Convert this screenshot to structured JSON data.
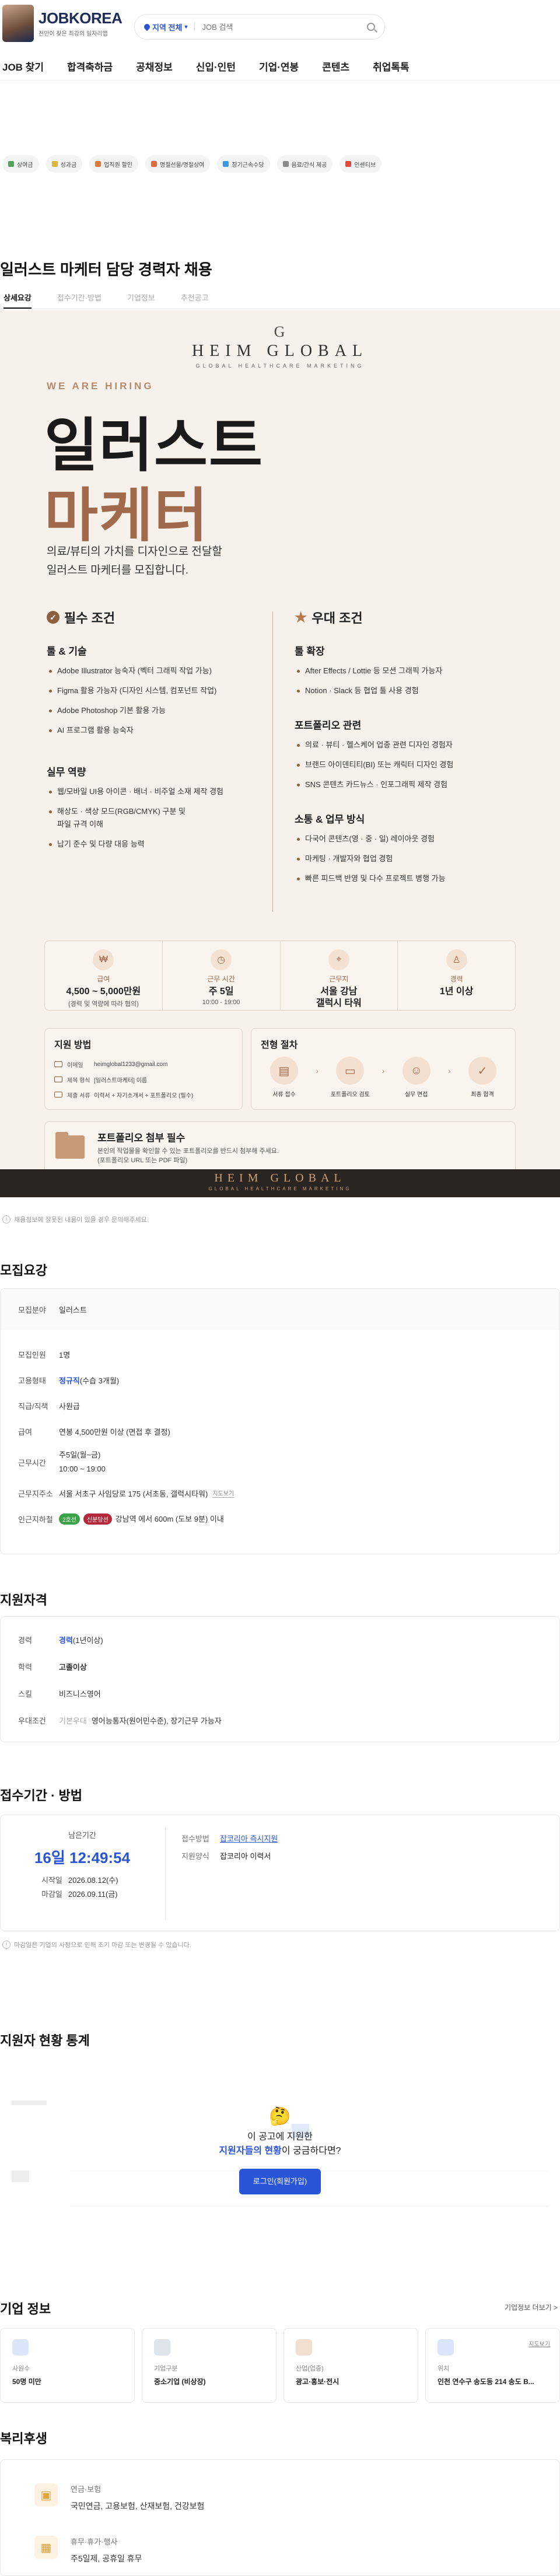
{
  "header": {
    "logo": "JOBKOREA",
    "logo_sub": "천만이 찾은 최강의 일자리앱",
    "location": "지역 전체",
    "search_placeholder": "JOB 검색"
  },
  "gnb": [
    "JOB 찾기",
    "합격축하금",
    "공채정보",
    "신입·인턴",
    "기업·연봉",
    "콘텐츠",
    "취업톡톡"
  ],
  "chips": [
    {
      "label": "상여금",
      "color": "#5aa05a"
    },
    {
      "label": "성과금",
      "color": "#e2b33c"
    },
    {
      "label": "업직원 할인",
      "color": "#e27a3c"
    },
    {
      "label": "명절선물/명절상여",
      "color": "#e26a3c"
    },
    {
      "label": "장기근속수당",
      "color": "#3c9ae2"
    },
    {
      "label": "음료/간식 제공",
      "color": "#8a8a8a"
    },
    {
      "label": "인센티브",
      "color": "#e24a3c"
    }
  ],
  "title": "일러스트 마케터 담당 경력자 채용",
  "tabs": [
    "상세요강",
    "접수기간·방법",
    "기업정보",
    "추천공고"
  ],
  "poster": {
    "g": "G",
    "brand": "HEIM GLOBAL",
    "brand_sub": "GLOBAL HEALTHCARE MARKETING",
    "hiring": "WE ARE HIRING",
    "title1": "일러스트",
    "title2": "마케터",
    "intro1": "의료/뷰티의 가치를 디자인으로 전달할",
    "intro2": "일러스트 마케터를 모집합니다.",
    "req": {
      "head": "필수 조건",
      "tool_h": "툴 & 기술",
      "tools": [
        "Adobe Illustrator 능숙자 (벡터 그래픽 작업 가능)",
        "Figma 활용 가능자 (디자인 시스템, 컴포넌트 작업)",
        "Adobe Photoshop 기본 활용 가능",
        "AI 프로그램 활용 능숙자"
      ],
      "work_h": "실무 역량",
      "works": [
        "웹/모바일 UI용 아이콘 · 배너 · 비주얼 소재 제작 경험",
        "해상도 · 색상 모드(RGB/CMYK) 구분 및",
        "파일 규격 이해",
        "납기 준수 및 다량 대응 능력"
      ]
    },
    "pref": {
      "head": "우대 조건",
      "exp_h": "툴 확장",
      "exps": [
        "After Effects / Lottie 등 모션 그래픽 가능자",
        "Notion · Slack 등 협업 툴 사용 경험"
      ],
      "port_h": "포트폴리오 관련",
      "ports": [
        "의료 · 뷰티 · 헬스케어 업종 관련 디자인 경험자",
        "브랜드 아이덴티티(BI) 또는 캐릭터 디자인 경험",
        "SNS 콘텐츠 카드뉴스 · 인포그래픽 제작 경험"
      ],
      "comm_h": "소통 & 업무 방식",
      "comms": [
        "다국어 콘텐츠(영 · 중 · 일) 레이아웃 경험",
        "마케팅 · 개발자와 협업 경험",
        "빠른 피드백 반영 및 다수 프로젝트 병행 가능"
      ]
    },
    "info": [
      {
        "icon": "₩",
        "label": "급여",
        "value": "4,500 ~ 5,000만원",
        "sub": "(경력 및 역량에 따라 협의)"
      },
      {
        "icon": "◷",
        "label": "근무 시간",
        "value": "주 5일",
        "sub": "10:00 - 19:00"
      },
      {
        "icon": "⌖",
        "label": "근무지",
        "value": "서울 강남",
        "sub": "갤럭시 타워"
      },
      {
        "icon": "♙",
        "label": "경력",
        "value": "1년 이상",
        "sub": ""
      }
    ],
    "apply": {
      "head": "지원 방법",
      "rows": [
        {
          "k": "이메일",
          "v": "heimglobal1233@gmail.com"
        },
        {
          "k": "제목 형식",
          "v": "[일러스트마케터] 이름"
        },
        {
          "k": "제출 서류",
          "v": "이력서 + 자기소개서 + 포트폴리오 (필수)"
        }
      ]
    },
    "proc": {
      "head": "전형 절차",
      "steps": [
        {
          "icon": "▤",
          "l": "서류 접수"
        },
        {
          "icon": "▭",
          "l": "포트폴리오 검토"
        },
        {
          "icon": "☺",
          "l": "실무 면접"
        },
        {
          "icon": "✓",
          "l": "최종 합격"
        }
      ]
    },
    "port": {
      "t": "포트폴리오 첨부 필수",
      "s1": "본인의 작업물을 확인할 수 있는 포트폴리오를 반드시 첨부해 주세요.",
      "s2": "(포트폴리오 URL 또는 PDF 파일)"
    },
    "foot1": "HEIM GLOBAL",
    "foot2": "GLOBAL HEALTHCARE MARKETING"
  },
  "notice": "채용정보에 잘못된 내용이 있을 경우 문의해주세요.",
  "summary": {
    "head": "모집요강",
    "rows": [
      {
        "k": "모집분야",
        "v": "일러스트"
      },
      {
        "k": "모집인원",
        "v": "1명"
      },
      {
        "k": "고용형태",
        "v1": "정규직",
        "v2": "(수습 3개월)"
      },
      {
        "k": "직급/직책",
        "v": "사원급"
      },
      {
        "k": "급여",
        "v": "연봉 4,500만원 이상 (면접 후 결정)"
      },
      {
        "k": "근무시간",
        "v1": "주5일(월~금)",
        "v2": "10:00 ~ 19:00"
      },
      {
        "k": "근무지주소",
        "v": "서울 서초구 사임당로 175 (서초동, 갤럭시타워)",
        "link": "지도보기"
      },
      {
        "k": "인근지하철",
        "tag1": "2호선",
        "tag2": "신분당선",
        "v": "강남역 에서 600m (도보 9분) 이내"
      }
    ]
  },
  "qual": {
    "head": "지원자격",
    "rows": [
      {
        "k": "경력",
        "v1": "경력",
        "v2": "(1년이상)"
      },
      {
        "k": "학력",
        "v": "고졸이상"
      },
      {
        "k": "스킬",
        "v": "비즈니스영어"
      },
      {
        "k": "우대조건",
        "v0": "기본우대",
        "v": "영어능통자(원어민수준), 장기근무 가능자"
      }
    ]
  },
  "deadline": {
    "head": "접수기간 · 방법",
    "left_label": "남은기간",
    "time": "16일 12:49:54",
    "start_k": "시작일",
    "start": "2026.08.12(수)",
    "end_k": "마감일",
    "end": "2026.09.11(금)",
    "method_k": "접수방법",
    "method": "잡코리아 즉시지원",
    "form_k": "지원양식",
    "form": "잡코리아 이력서"
  },
  "deadline_note": "마감일은 기업의 사정으로 인해 조기 마감 또는 변경될 수 있습니다.",
  "stats": {
    "head": "지원자 현황 통계",
    "q1": "이 공고에 지원한",
    "q2_b": "지원자들의 현황",
    "q2": "이 궁금하다면?",
    "btn": "로그인(회원가입)"
  },
  "company": {
    "head": "기업 정보",
    "more": "기업정보 더보기 >",
    "cards": [
      {
        "l": "사원수",
        "v": "50명 미만",
        "c": "#dce6fb"
      },
      {
        "l": "기업구분",
        "v": "중소기업 (비상장)",
        "c": "#dfe3ea"
      },
      {
        "l": "산업(업종)",
        "v": "광고·홍보·전시",
        "c": "#f1dfcf"
      },
      {
        "l": "위치",
        "v": "인천 연수구 송도동 214 송도 B...",
        "c": "#dce6fb",
        "map": "지도보기"
      }
    ]
  },
  "welfare": {
    "head": "복리후생",
    "items": [
      {
        "t": "연금·보험",
        "v": "국민연금, 고용보험, 산재보험, 건강보험"
      },
      {
        "t": "휴무·휴가·행사",
        "v": "주5일제, 공휴일 휴무"
      }
    ]
  }
}
